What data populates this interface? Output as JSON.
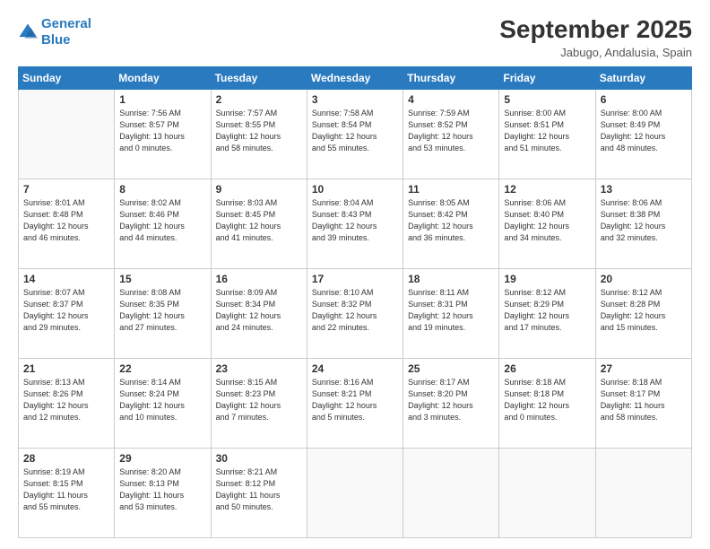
{
  "logo": {
    "line1": "General",
    "line2": "Blue"
  },
  "header": {
    "month": "September 2025",
    "location": "Jabugo, Andalusia, Spain"
  },
  "weekdays": [
    "Sunday",
    "Monday",
    "Tuesday",
    "Wednesday",
    "Thursday",
    "Friday",
    "Saturday"
  ],
  "weeks": [
    [
      {
        "day": "",
        "info": ""
      },
      {
        "day": "1",
        "info": "Sunrise: 7:56 AM\nSunset: 8:57 PM\nDaylight: 13 hours\nand 0 minutes."
      },
      {
        "day": "2",
        "info": "Sunrise: 7:57 AM\nSunset: 8:55 PM\nDaylight: 12 hours\nand 58 minutes."
      },
      {
        "day": "3",
        "info": "Sunrise: 7:58 AM\nSunset: 8:54 PM\nDaylight: 12 hours\nand 55 minutes."
      },
      {
        "day": "4",
        "info": "Sunrise: 7:59 AM\nSunset: 8:52 PM\nDaylight: 12 hours\nand 53 minutes."
      },
      {
        "day": "5",
        "info": "Sunrise: 8:00 AM\nSunset: 8:51 PM\nDaylight: 12 hours\nand 51 minutes."
      },
      {
        "day": "6",
        "info": "Sunrise: 8:00 AM\nSunset: 8:49 PM\nDaylight: 12 hours\nand 48 minutes."
      }
    ],
    [
      {
        "day": "7",
        "info": "Sunrise: 8:01 AM\nSunset: 8:48 PM\nDaylight: 12 hours\nand 46 minutes."
      },
      {
        "day": "8",
        "info": "Sunrise: 8:02 AM\nSunset: 8:46 PM\nDaylight: 12 hours\nand 44 minutes."
      },
      {
        "day": "9",
        "info": "Sunrise: 8:03 AM\nSunset: 8:45 PM\nDaylight: 12 hours\nand 41 minutes."
      },
      {
        "day": "10",
        "info": "Sunrise: 8:04 AM\nSunset: 8:43 PM\nDaylight: 12 hours\nand 39 minutes."
      },
      {
        "day": "11",
        "info": "Sunrise: 8:05 AM\nSunset: 8:42 PM\nDaylight: 12 hours\nand 36 minutes."
      },
      {
        "day": "12",
        "info": "Sunrise: 8:06 AM\nSunset: 8:40 PM\nDaylight: 12 hours\nand 34 minutes."
      },
      {
        "day": "13",
        "info": "Sunrise: 8:06 AM\nSunset: 8:38 PM\nDaylight: 12 hours\nand 32 minutes."
      }
    ],
    [
      {
        "day": "14",
        "info": "Sunrise: 8:07 AM\nSunset: 8:37 PM\nDaylight: 12 hours\nand 29 minutes."
      },
      {
        "day": "15",
        "info": "Sunrise: 8:08 AM\nSunset: 8:35 PM\nDaylight: 12 hours\nand 27 minutes."
      },
      {
        "day": "16",
        "info": "Sunrise: 8:09 AM\nSunset: 8:34 PM\nDaylight: 12 hours\nand 24 minutes."
      },
      {
        "day": "17",
        "info": "Sunrise: 8:10 AM\nSunset: 8:32 PM\nDaylight: 12 hours\nand 22 minutes."
      },
      {
        "day": "18",
        "info": "Sunrise: 8:11 AM\nSunset: 8:31 PM\nDaylight: 12 hours\nand 19 minutes."
      },
      {
        "day": "19",
        "info": "Sunrise: 8:12 AM\nSunset: 8:29 PM\nDaylight: 12 hours\nand 17 minutes."
      },
      {
        "day": "20",
        "info": "Sunrise: 8:12 AM\nSunset: 8:28 PM\nDaylight: 12 hours\nand 15 minutes."
      }
    ],
    [
      {
        "day": "21",
        "info": "Sunrise: 8:13 AM\nSunset: 8:26 PM\nDaylight: 12 hours\nand 12 minutes."
      },
      {
        "day": "22",
        "info": "Sunrise: 8:14 AM\nSunset: 8:24 PM\nDaylight: 12 hours\nand 10 minutes."
      },
      {
        "day": "23",
        "info": "Sunrise: 8:15 AM\nSunset: 8:23 PM\nDaylight: 12 hours\nand 7 minutes."
      },
      {
        "day": "24",
        "info": "Sunrise: 8:16 AM\nSunset: 8:21 PM\nDaylight: 12 hours\nand 5 minutes."
      },
      {
        "day": "25",
        "info": "Sunrise: 8:17 AM\nSunset: 8:20 PM\nDaylight: 12 hours\nand 3 minutes."
      },
      {
        "day": "26",
        "info": "Sunrise: 8:18 AM\nSunset: 8:18 PM\nDaylight: 12 hours\nand 0 minutes."
      },
      {
        "day": "27",
        "info": "Sunrise: 8:18 AM\nSunset: 8:17 PM\nDaylight: 11 hours\nand 58 minutes."
      }
    ],
    [
      {
        "day": "28",
        "info": "Sunrise: 8:19 AM\nSunset: 8:15 PM\nDaylight: 11 hours\nand 55 minutes."
      },
      {
        "day": "29",
        "info": "Sunrise: 8:20 AM\nSunset: 8:13 PM\nDaylight: 11 hours\nand 53 minutes."
      },
      {
        "day": "30",
        "info": "Sunrise: 8:21 AM\nSunset: 8:12 PM\nDaylight: 11 hours\nand 50 minutes."
      },
      {
        "day": "",
        "info": ""
      },
      {
        "day": "",
        "info": ""
      },
      {
        "day": "",
        "info": ""
      },
      {
        "day": "",
        "info": ""
      }
    ]
  ]
}
